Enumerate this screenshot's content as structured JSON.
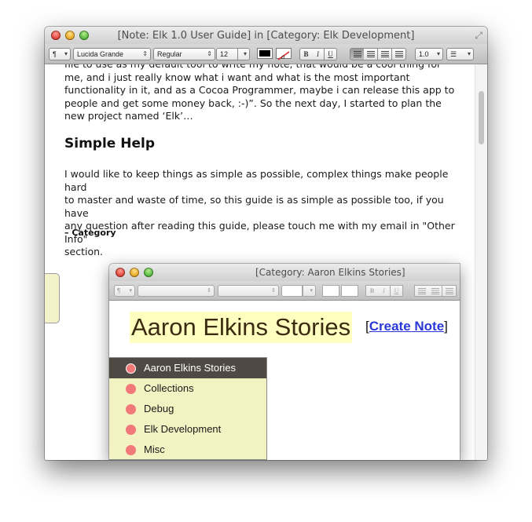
{
  "window": {
    "title": "[Note: Elk 1.0 User Guide] in [Category: Elk Development]"
  },
  "toolbar": {
    "paragraph_style": "¶",
    "font_family": "Lucida Grande",
    "font_style": "Regular",
    "font_size": "12",
    "bold": "B",
    "italic": "I",
    "underline": "U",
    "line_spacing": "1.0",
    "list_style": "☰",
    "text_color": "#000000"
  },
  "document": {
    "intro_lines": [
      "file to use as my default tool to write my note, that would be a cool thing for",
      "me, and i just really know what i want and what is the most important",
      "functionality in it, and as a Cocoa Programmer, maybe i can release this app to",
      "people and get some money back, :-)”. So the next day,  I started to plan the",
      "new project named ‘Elk’…"
    ],
    "heading": "Simple Help",
    "help_lines": [
      "I would like to keep things as simple as possible, complex things make people hard",
      "to master and waste of time, so this guide is as simple as possible too, if you have",
      "any question after reading this guide, please touch me with my email in \"Other Info\"",
      "section."
    ],
    "category_label": "– Category"
  },
  "screenshot": {
    "window_title": "[Category: Aaron Elkins Stories]",
    "heading": "Aaron Elkins Stories",
    "create_note_open": "[",
    "create_note_link": "Create Note",
    "create_note_close": "]",
    "categories": [
      "Aaron Elkins Stories",
      "Collections",
      "Debug",
      "Elk Development",
      "Misc"
    ]
  }
}
